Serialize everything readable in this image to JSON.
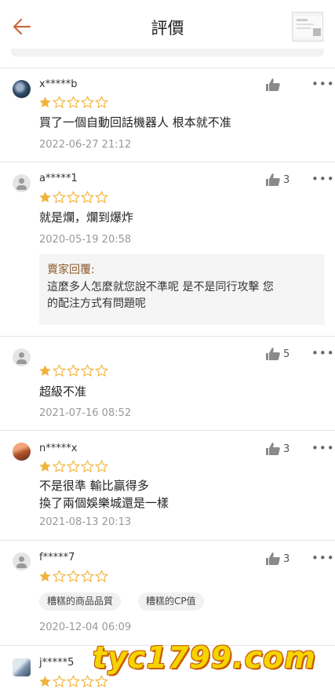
{
  "header": {
    "title": "評價",
    "back_icon": "arrow-left-icon",
    "accent_color": "#c86a3c"
  },
  "colors": {
    "star_filled": "#f0b33a",
    "star_empty": "#f0b33a",
    "reply_label": "#8a5a2b",
    "watermark": "#f5d400"
  },
  "reviews": [
    {
      "user": "x*****b",
      "rating": 1,
      "likes": "",
      "text": "買了一個自動回話機器人 根本就不准",
      "date": "2022-06-27 21:12"
    },
    {
      "user": "a*****1",
      "rating": 1,
      "likes": "3",
      "text": "就是爛，爛到爆炸",
      "date": "2020-05-19 20:58",
      "reply": {
        "label": "賣家回覆:",
        "line1": "這麼多人怎麼就您說不準呢 是不是同行攻擊 您",
        "line2": "的配注方式有問題呢"
      }
    },
    {
      "user": "",
      "rating": 1,
      "likes": "5",
      "text": "超級不准",
      "date": "2021-07-16 08:52"
    },
    {
      "user": "n*****x",
      "rating": 1,
      "likes": "3",
      "text_line1": "不是很準 輸比贏得多",
      "text_line2": "換了兩個娛樂城還是一樣",
      "date": "2021-08-13 20:13"
    },
    {
      "user": "f*****7",
      "rating": 1,
      "likes": "3",
      "tags": [
        "糟糕的商品品質",
        "糟糕的CP值"
      ],
      "date": "2020-12-04 06:09"
    },
    {
      "user": "j*****5",
      "rating": 1
    }
  ],
  "more_label": "•••",
  "watermark": "tyc1799.com"
}
